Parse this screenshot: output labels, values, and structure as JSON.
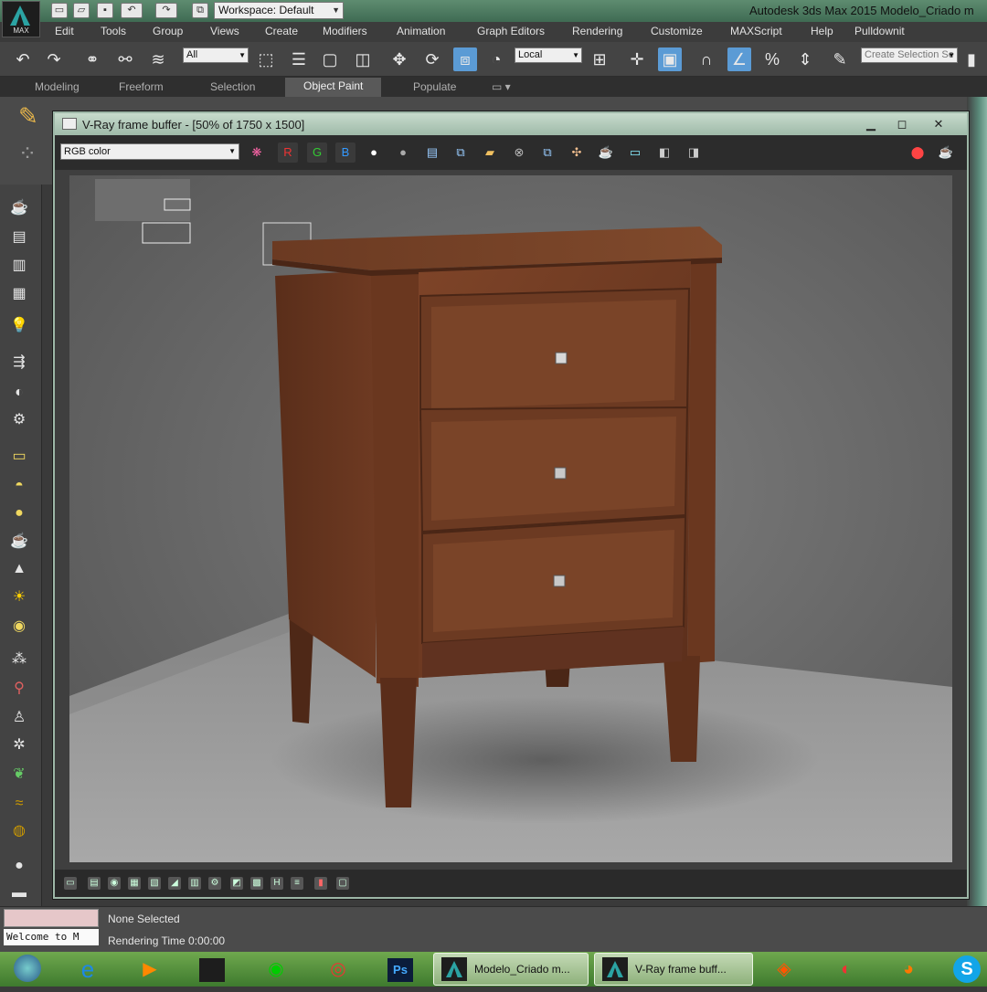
{
  "window": {
    "app_title": "Autodesk 3ds Max  2015    Modelo_Criado m",
    "logo_text": "MAX",
    "workspace_label": "Workspace: Default"
  },
  "menu": [
    "Edit",
    "Tools",
    "Group",
    "Views",
    "Create",
    "Modifiers",
    "Animation",
    "Graph Editors",
    "Rendering",
    "Customize",
    "MAXScript",
    "Help",
    "Pulldownit"
  ],
  "toolbar": {
    "filter_value": "All",
    "coord_value": "Local",
    "selection_set_placeholder": "Create Selection Se"
  },
  "ribbon": {
    "tabs": [
      "Modeling",
      "Freeform",
      "Selection",
      "Object Paint",
      "Populate"
    ],
    "active_tab": "Object Paint"
  },
  "vfb": {
    "title": "V-Ray frame buffer - [50% of 1750 x 1500]",
    "channel": "RGB color",
    "rgb_buttons": [
      "R",
      "G",
      "B"
    ]
  },
  "status": {
    "listener_text": "Welcome to M",
    "selection": "None Selected",
    "render_time": "Rendering Time  0:00:00"
  },
  "taskbar": {
    "buttons": [
      "Modelo_Criado m...",
      "V-Ray frame buff..."
    ],
    "ps_label": "Ps"
  },
  "colors": {
    "title_green": "#4f7d63",
    "active_blue": "#5b9bd5",
    "wood": "#6b3a22",
    "taskbar_green": "#5a9440"
  }
}
